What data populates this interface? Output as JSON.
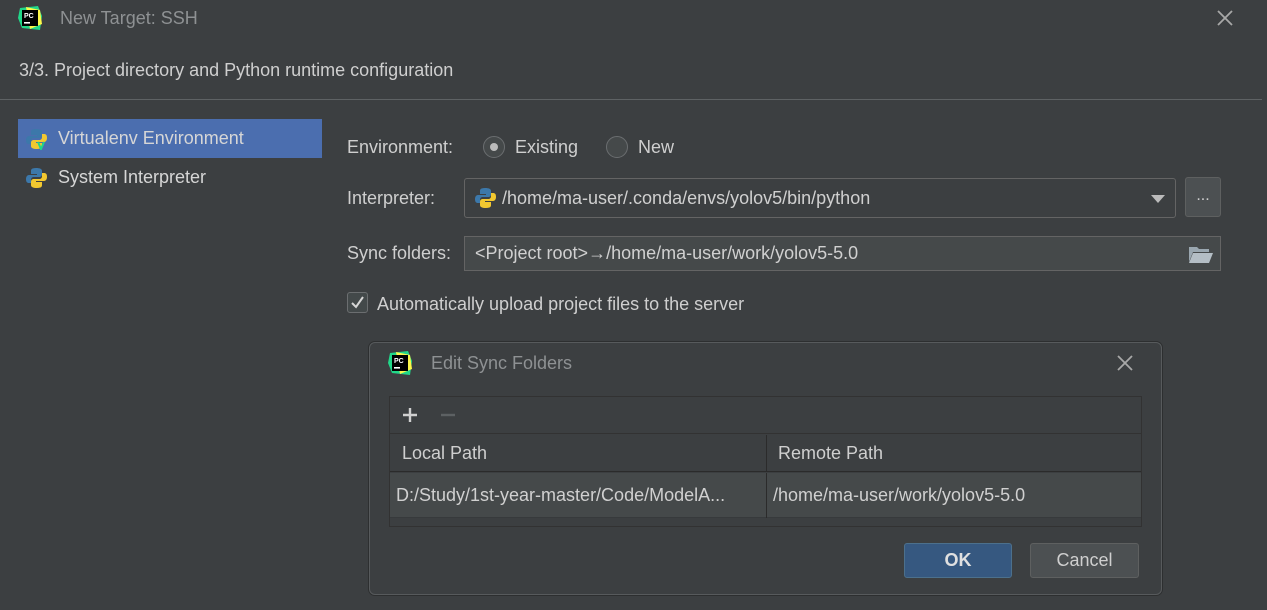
{
  "window": {
    "title": "New Target: SSH",
    "step_title": "3/3. Project directory and Python runtime configuration",
    "logo_text": "PC"
  },
  "sidebar": {
    "items": [
      {
        "label": "Virtualenv Environment",
        "selected": true,
        "icon": "python-virtualenv-icon"
      },
      {
        "label": "System Interpreter",
        "selected": false,
        "icon": "python-icon"
      }
    ]
  },
  "form": {
    "environment_label": "Environment:",
    "env_options": [
      {
        "label": "Existing",
        "checked": true
      },
      {
        "label": "New",
        "checked": false
      }
    ],
    "interpreter_label": "Interpreter:",
    "interpreter_value": "/home/ma-user/.conda/envs/yolov5/bin/python",
    "browse_label": "...",
    "sync_label": "Sync folders:",
    "sync_value": "<Project root>→/home/ma-user/work/yolov5-5.0",
    "auto_upload_label": "Automatically upload project files to the server",
    "auto_upload_checked": true
  },
  "dialog": {
    "title": "Edit Sync Folders",
    "logo_text": "PC",
    "columns": [
      "Local Path",
      "Remote Path"
    ],
    "rows": [
      {
        "local": "D:/Study/1st-year-master/Code/ModelA...",
        "remote": "/home/ma-user/work/yolov5-5.0"
      }
    ],
    "ok_label": "OK",
    "cancel_label": "Cancel"
  },
  "colors": {
    "background": "#3c3f41",
    "selection": "#4b6eaf",
    "ok_button": "#365880",
    "python_blue": "#3c78aa",
    "python_yellow": "#f2c830",
    "pycharm_green": "#21d789"
  }
}
